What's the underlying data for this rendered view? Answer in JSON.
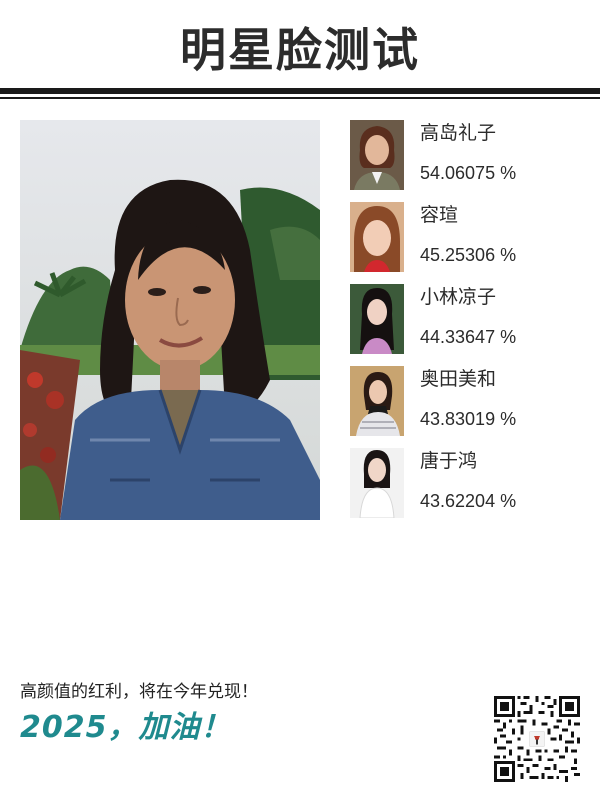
{
  "header": {
    "title": "明星脸测试"
  },
  "main_photo": {
    "icon": "portrait-photo"
  },
  "matches": [
    {
      "name": "高岛礼子",
      "score": "54.06075 %"
    },
    {
      "name": "容瑄",
      "score": "45.25306 %"
    },
    {
      "name": "小林凉子",
      "score": "44.33647 %"
    },
    {
      "name": "奥田美和",
      "score": "43.83019 %"
    },
    {
      "name": "唐于鸿",
      "score": "43.62204 %"
    }
  ],
  "footer": {
    "slogan": "高颜值的红利，将在今年兑现！",
    "cheer": "2025，加油！",
    "qr_icon": "qr-code-icon"
  },
  "colors": {
    "accent": "#1f8a8e",
    "text": "#2a2a2a",
    "rule": "#1a1a1a"
  }
}
